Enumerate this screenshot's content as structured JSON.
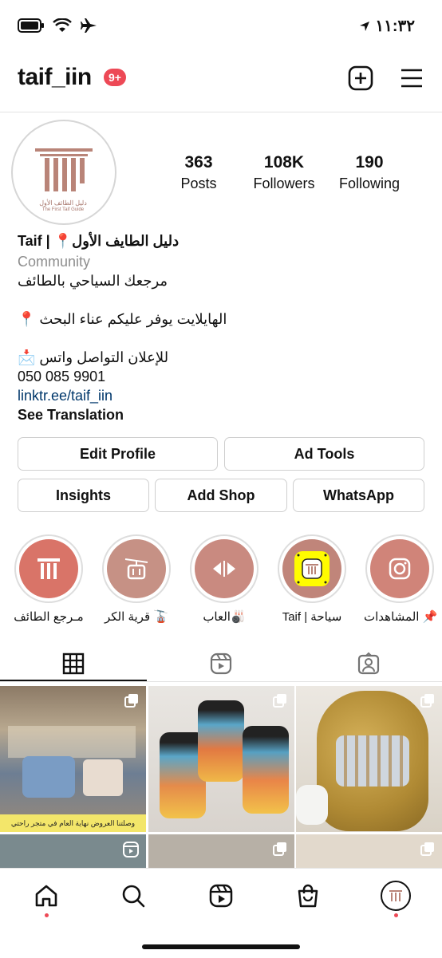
{
  "status_bar": {
    "time": "١١:٣٢"
  },
  "header": {
    "username": "taif_iin",
    "notification_badge": "9+"
  },
  "profile": {
    "avatar_text": "دليل الطائف الأول",
    "avatar_subtext": "The First Taif Guide",
    "stats": [
      {
        "value": "363",
        "label": "Posts"
      },
      {
        "value": "108K",
        "label": "Followers"
      },
      {
        "value": "190",
        "label": "Following"
      }
    ],
    "name": "Taif | 📍دليل الطايف الأول",
    "category": "Community",
    "bio_line1": "مرجعك السياحي بالطائف",
    "bio_line2": "الهايلايت يوفر عليكم عناء البحث 📍",
    "bio_line3": "للإعلان التواصل واتس 📩",
    "phone": "050 085 9901",
    "link": "linktr.ee/taif_iin",
    "see_translation": "See Translation"
  },
  "actions": {
    "edit_profile": "Edit Profile",
    "ad_tools": "Ad Tools",
    "insights": "Insights",
    "add_shop": "Add Shop",
    "whatsapp": "WhatsApp"
  },
  "highlights": [
    {
      "label": "مـرجع الطائف"
    },
    {
      "label": "قرية الكر 🚡"
    },
    {
      "label": "العاب🎳"
    },
    {
      "label": "Taif | سياحة"
    },
    {
      "label": "المشاهدات 📌"
    }
  ],
  "posts": [
    {
      "caption": "وصلتنا العروض نهاية العام في متجر راحتي بالطائف"
    }
  ],
  "colors": {
    "accent_red": "#ed4956",
    "highlight_fill": "#d97468",
    "link_blue": "#00376b"
  }
}
